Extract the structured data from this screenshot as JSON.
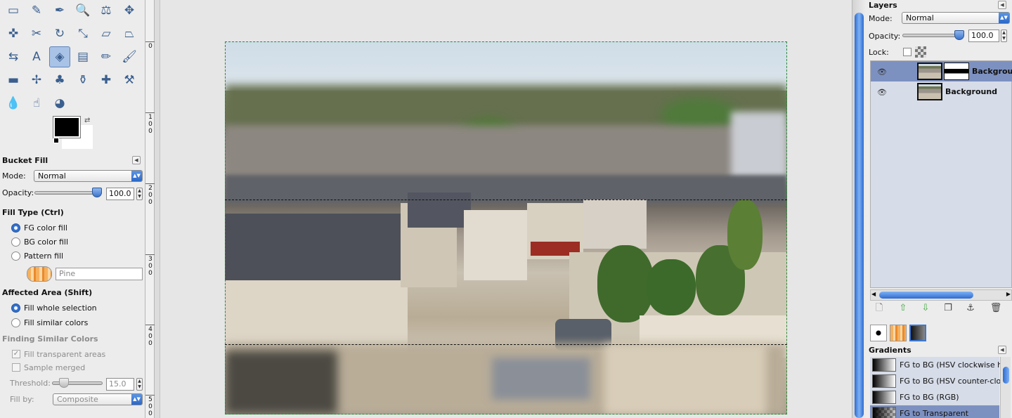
{
  "toolbox": {
    "tools": [
      {
        "name": "rect-select-icon",
        "glyph": "▭"
      },
      {
        "name": "fuzzy-select-icon",
        "glyph": "✎"
      },
      {
        "name": "color-picker-icon",
        "glyph": "✒"
      },
      {
        "name": "zoom-icon",
        "glyph": "🔍"
      },
      {
        "name": "measure-icon",
        "glyph": "⚖"
      },
      {
        "name": "move-icon",
        "glyph": "✥"
      },
      {
        "name": "align-icon",
        "glyph": "✜"
      },
      {
        "name": "crop-icon",
        "glyph": "✂"
      },
      {
        "name": "rotate-icon",
        "glyph": "↻"
      },
      {
        "name": "scale-icon",
        "glyph": "⤡"
      },
      {
        "name": "shear-icon",
        "glyph": "▱"
      },
      {
        "name": "perspective-icon",
        "glyph": "⏢"
      },
      {
        "name": "flip-icon",
        "glyph": "⇆"
      },
      {
        "name": "text-icon",
        "glyph": "A"
      },
      {
        "name": "bucket-fill-icon",
        "glyph": "◈"
      },
      {
        "name": "blend-icon",
        "glyph": "▤"
      },
      {
        "name": "pencil-icon",
        "glyph": "✏"
      },
      {
        "name": "paintbrush-icon",
        "glyph": "🖌"
      },
      {
        "name": "eraser-icon",
        "glyph": "▬"
      },
      {
        "name": "airbrush-icon",
        "glyph": "✢"
      },
      {
        "name": "ink-icon",
        "glyph": "♣"
      },
      {
        "name": "clone-icon",
        "glyph": "⚱"
      },
      {
        "name": "heal-icon",
        "glyph": "✚"
      },
      {
        "name": "perspective-clone-icon",
        "glyph": "⚒"
      },
      {
        "name": "blur-icon",
        "glyph": "💧"
      },
      {
        "name": "smudge-icon",
        "glyph": "☝"
      },
      {
        "name": "dodge-burn-icon",
        "glyph": "◕"
      }
    ],
    "active_tool_index": 14
  },
  "tool_options": {
    "title": "Bucket Fill",
    "mode_label": "Mode:",
    "mode_value": "Normal",
    "opacity_label": "Opacity:",
    "opacity_value": "100.0",
    "opacity_fraction": 1.0,
    "fill_type_title": "Fill Type  (Ctrl)",
    "fill_type_options": [
      "FG color fill",
      "BG color fill",
      "Pattern fill"
    ],
    "fill_type_selected": 0,
    "pattern_placeholder": "Pine",
    "affected_area_title": "Affected Area  (Shift)",
    "affected_area_options": [
      "Fill whole selection",
      "Fill similar colors"
    ],
    "affected_area_selected": 0,
    "similar_title": "Finding Similar Colors",
    "fill_transparent": "Fill transparent areas",
    "sample_merged": "Sample merged",
    "threshold_label": "Threshold:",
    "threshold_value": "15.0",
    "fill_by_label": "Fill by:",
    "fill_by_value": "Composite"
  },
  "ruler": {
    "labels": [
      "0",
      "100",
      "200",
      "300",
      "400",
      "500"
    ]
  },
  "layers": {
    "title": "Layers",
    "mode_label": "Mode:",
    "mode_value": "Normal",
    "opacity_label": "Opacity:",
    "opacity_value": "100.0",
    "opacity_fraction": 1.0,
    "lock_label": "Lock:",
    "items": [
      {
        "name": "Background",
        "has_mask": true,
        "selected": true
      },
      {
        "name": "Background",
        "has_mask": false,
        "selected": false
      }
    ]
  },
  "gradients": {
    "title": "Gradients",
    "items": [
      {
        "name": "FG to BG (HSV clockwise h",
        "selected": false
      },
      {
        "name": "FG to BG (HSV counter-clo",
        "selected": false
      },
      {
        "name": "FG to BG (RGB)",
        "selected": false
      },
      {
        "name": "FG to Transparent",
        "selected": true
      }
    ]
  },
  "colors": {
    "accent": "#2f6fd1",
    "selection_row": "#7d91c1",
    "selection_border": "#2a8a3a"
  }
}
